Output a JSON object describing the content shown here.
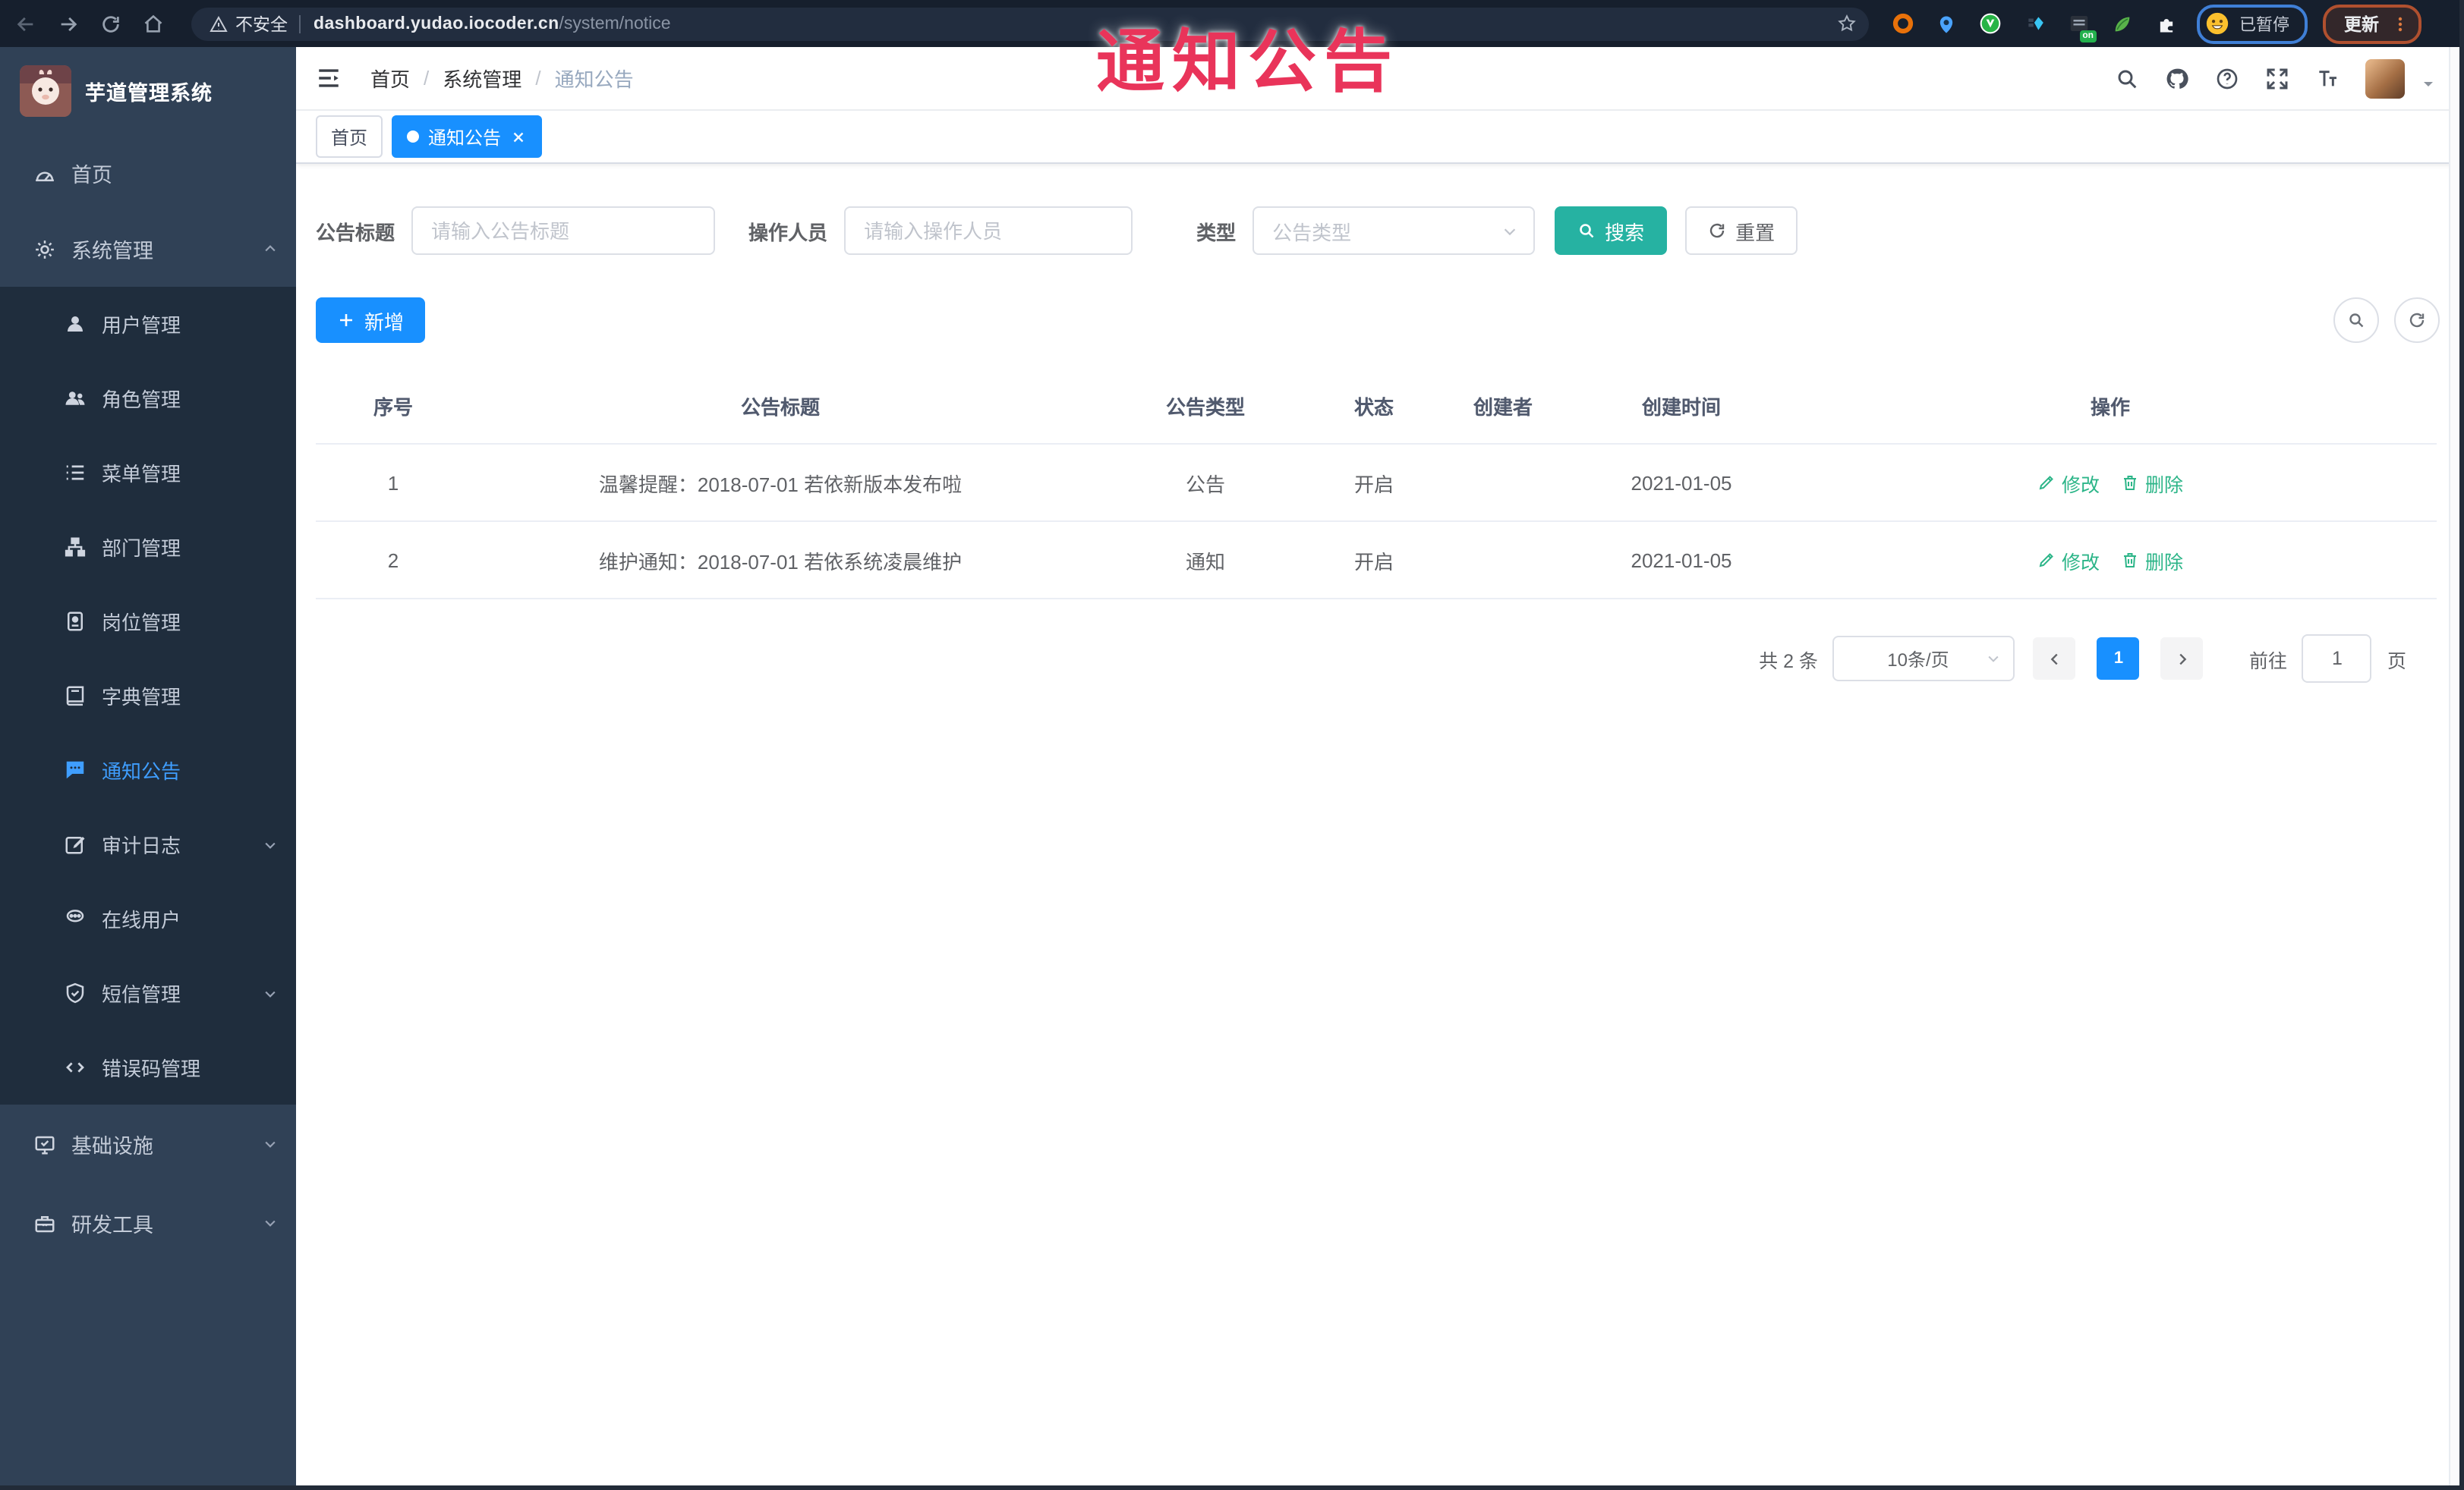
{
  "overlay": {
    "text": "通知公告"
  },
  "browser": {
    "security_label": "不安全",
    "url_host": "dashboard.yudao.iocoder.cn",
    "url_path": "/system/notice",
    "profile_status": "已暂停",
    "update_label": "更新",
    "extension_badge": "on"
  },
  "sidebar": {
    "app_title": "芋道管理系统",
    "menu": [
      {
        "label": "首页"
      },
      {
        "label": "系统管理"
      },
      {
        "label": "用户管理"
      },
      {
        "label": "角色管理"
      },
      {
        "label": "菜单管理"
      },
      {
        "label": "部门管理"
      },
      {
        "label": "岗位管理"
      },
      {
        "label": "字典管理"
      },
      {
        "label": "通知公告"
      },
      {
        "label": "审计日志"
      },
      {
        "label": "在线用户"
      },
      {
        "label": "短信管理"
      },
      {
        "label": "错误码管理"
      },
      {
        "label": "基础设施"
      },
      {
        "label": "研发工具"
      }
    ]
  },
  "header": {
    "breadcrumb": [
      "首页",
      "系统管理",
      "通知公告"
    ],
    "breadcrumb_separator": "/"
  },
  "tabs": [
    {
      "label": "首页"
    },
    {
      "label": "通知公告"
    }
  ],
  "search": {
    "title_label": "公告标题",
    "title_placeholder": "请输入公告标题",
    "operator_label": "操作人员",
    "operator_placeholder": "请输入操作人员",
    "type_label": "类型",
    "type_placeholder": "公告类型",
    "search_label": "搜索",
    "reset_label": "重置"
  },
  "toolbar": {
    "add_label": "新增"
  },
  "table": {
    "columns": [
      "序号",
      "公告标题",
      "公告类型",
      "状态",
      "创建者",
      "创建时间",
      "操作"
    ],
    "rows": [
      {
        "no": "1",
        "title": "温馨提醒：2018-07-01 若依新版本发布啦",
        "type": "公告",
        "status": "开启",
        "creator": "",
        "time": "2021-01-05",
        "edit": "修改",
        "del": "删除"
      },
      {
        "no": "2",
        "title": "维护通知：2018-07-01 若依系统凌晨维护",
        "type": "通知",
        "status": "开启",
        "creator": "",
        "time": "2021-01-05",
        "edit": "修改",
        "del": "删除"
      }
    ]
  },
  "pagination": {
    "total": "共 2 条",
    "size": "10条/页",
    "page": "1",
    "goto": "前往",
    "goto_value": "1",
    "unit": "页"
  },
  "colors": {
    "primary_blue": "#1890ff",
    "menu_active_blue": "#3f9eff",
    "search_teal": "#26b2a2",
    "action_link_green": "#2cb588",
    "sidebar_bg": "#304156",
    "submenu_bg": "#1f2d3d",
    "browser_bar_bg": "#161f2d",
    "overlay_red": "#e9345a"
  }
}
